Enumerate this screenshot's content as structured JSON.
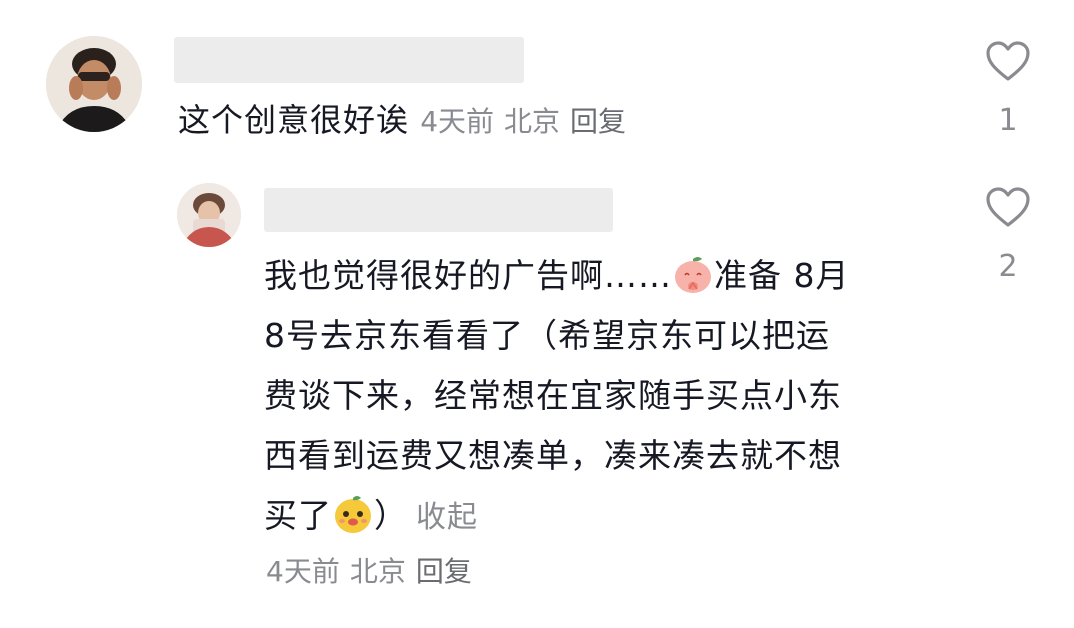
{
  "comments": [
    {
      "text": "这个创意很好诶",
      "time": "4天前",
      "location": "北京",
      "reply_label": "回复",
      "likes": "1"
    },
    {
      "lines": [
        "我也觉得很好的广告啊……",
        "准备 8月",
        "8号去京东看看了（希望京东可以把运",
        "费谈下来，经常想在宜家随手买点小东",
        "西看到运费又想凑单，凑来凑去就不想",
        "买了",
        "）"
      ],
      "collapse_label": "收起",
      "time": "4天前",
      "location": "北京",
      "reply_label": "回复",
      "likes": "2"
    }
  ],
  "colors": {
    "text": "#161823",
    "meta": "#8a8b91",
    "placeholder_name": "#ececec"
  },
  "icons": {
    "like": "heart-outline-icon",
    "emoji_1": "praying-peach-emoji",
    "emoji_2": "happy-face-emoji"
  }
}
